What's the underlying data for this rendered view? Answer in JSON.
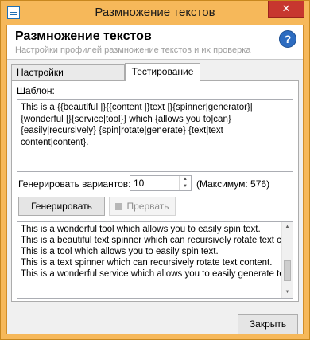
{
  "window": {
    "title": "Размножение текстов",
    "close_glyph": "✕"
  },
  "header": {
    "title": "Размножение текстов",
    "subtitle": "Настройки профилей размножение текстов и их проверка",
    "help_glyph": "?"
  },
  "tabs": [
    {
      "label": "Настройки размножения",
      "active": false
    },
    {
      "label": "Тестирование",
      "active": true
    }
  ],
  "template": {
    "label": "Шаблон:",
    "value": "This is a {{beautiful |}{{content |}text |}{spinner|generator}|{wonderful |}{service|tool}} which {allows you to|can} {easily|recursively} {spin|rotate|generate} {text|text content|content}."
  },
  "variants": {
    "label": "Генерировать вариантов:",
    "value": "10",
    "max_label": "(Максимум: 576)"
  },
  "buttons": {
    "generate": "Генерировать",
    "stop": "Прервать",
    "close": "Закрыть"
  },
  "output": {
    "lines": [
      "This is a wonderful tool which allows you to easily spin text.",
      "This is a beautiful text spinner which can recursively rotate text co",
      "This is a tool which allows you to easily spin text.",
      "This is a text spinner which can recursively rotate text content.",
      "This is a wonderful service which allows you to easily generate tex"
    ]
  },
  "colors": {
    "frame": "#f6b85a",
    "close": "#c7372f",
    "help": "#2d6cc0"
  }
}
